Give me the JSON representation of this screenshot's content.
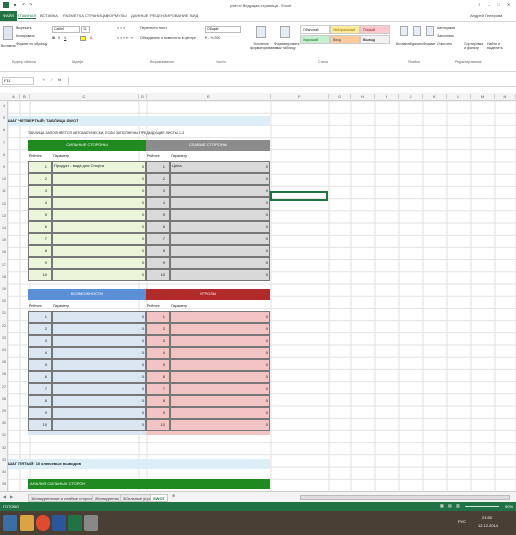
{
  "window": {
    "title": "учет.xl Ведущая страница - Excel",
    "user": "Андрей Генерова"
  },
  "ribbon_tabs": [
    "ФАЙЛ",
    "ГЛАВНАЯ",
    "ВСТАВКА",
    "РАЗМЕТКА СТРАНИЦЫ",
    "ФОРМУЛЫ",
    "ДАННЫЕ",
    "РЕЦЕНЗИРОВАНИЕ",
    "ВИД"
  ],
  "ribbon": {
    "paste": "Вставить",
    "cut": "Вырезать",
    "copy": "Копировать",
    "format_painter": "Формат по образцу",
    "font_name": "Calibri",
    "font_size": "11",
    "wrap_text": "Перенести текст",
    "merge": "Объединить и поместить в центре",
    "number_format": "Общий",
    "conditional": "Условное форматирование",
    "format_table": "Форматировать как таблицу",
    "styles": [
      "Обычный",
      "Нейтральный",
      "Плохой",
      "Хороший",
      "Ввод",
      "Вывод"
    ],
    "insert": "Вставить",
    "delete": "Удалить",
    "format": "Формат",
    "autosum": "Автосумма",
    "fill": "Заполнить",
    "clear": "Очистить",
    "sort": "Сортировка и фильтр",
    "find": "Найти и выделить",
    "groups": [
      "Буфер обмена",
      "Шрифт",
      "Выравнивание",
      "Число",
      "Стили",
      "Ячейки",
      "Редактирование"
    ]
  },
  "formula_bar": {
    "name_box": "F11",
    "fx": "fx",
    "value": ""
  },
  "columns": [
    "A",
    "B",
    "C",
    "D",
    "E",
    "F",
    "G",
    "H",
    "I",
    "J",
    "K",
    "L",
    "M",
    "N"
  ],
  "rows": [
    "4",
    "5",
    "6",
    "7",
    "8",
    "9",
    "10",
    "11",
    "12",
    "13",
    "14",
    "15",
    "16",
    "17",
    "18",
    "19",
    "20",
    "21",
    "22",
    "23",
    "24",
    "25",
    "26",
    "27",
    "28",
    "29",
    "30",
    "31",
    "32",
    "33",
    "34",
    "35"
  ],
  "sheet": {
    "heading": "ШАГ ЧЕТВЕРТЫЙ: ТАБЛИЦА SWOT",
    "note": "ТАБЛИЦА ЗАПОЛНЯЕТСЯ АВТОМАТИЧЕСКИ, ЕСЛИ ЗАПОЛНЕНЫ ПРЕДЫДУЩИЕ ЛИСТЫ 1-3",
    "strengths": "СИЛЬНЫЕ СТОРОНЫ",
    "weaknesses": "СЛАБЫЕ СТОРОНЫ",
    "opportunities": "ВОЗМОЖНОСТИ",
    "threats": "УГРОЗЫ",
    "rating": "Рейтинг",
    "parameter": "Параметр",
    "first_strength": "Продукт - вода для Спорта",
    "first_weakness": "Цена",
    "ranks": [
      "1",
      "2",
      "3",
      "4",
      "5",
      "6",
      "7",
      "8",
      "9",
      "10"
    ],
    "zero": "0",
    "step5": "ШАГ ПЯТЫЙ: 10 ключевых выводов",
    "analysis": "АНАЛИЗ СИЛЬНЫХ СТОРОН"
  },
  "sheet_tabs": [
    "1Конкурентные и слабые стороны",
    "2Конкуренты",
    "3Сильные угрозы",
    "SWOT"
  ],
  "status": {
    "ready": "ГОТОВО",
    "zoom": "90%"
  },
  "clock": {
    "time": "21:50",
    "date": "12.12.2014",
    "lang": "РУС"
  }
}
